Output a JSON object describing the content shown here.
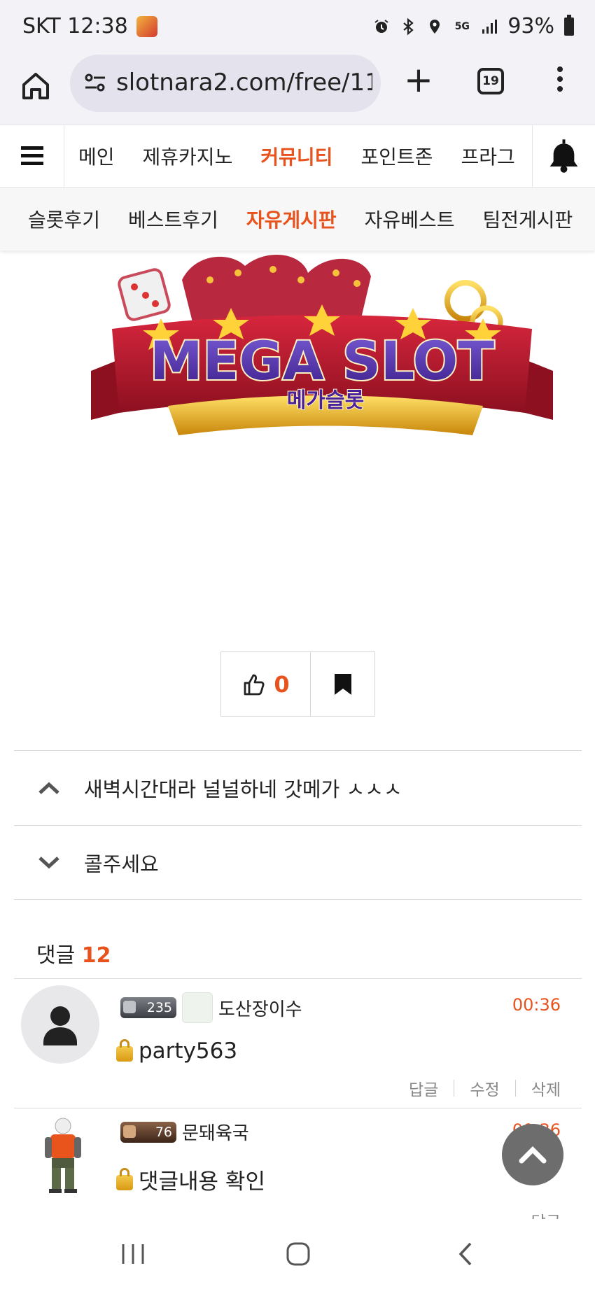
{
  "status_bar": {
    "carrier_time": "SKT 12:38",
    "network": "5G",
    "battery": "93%"
  },
  "browser": {
    "url": "slotnara2.com/free/11",
    "tab_count": "19"
  },
  "site_nav": {
    "items": [
      {
        "label": "메인",
        "active": false
      },
      {
        "label": "제휴카지노",
        "active": false
      },
      {
        "label": "커뮤니티",
        "active": true
      },
      {
        "label": "포인트존",
        "active": false
      },
      {
        "label": "프라그",
        "active": false
      }
    ]
  },
  "sub_nav": {
    "items": [
      {
        "label": "슬롯후기",
        "active": false
      },
      {
        "label": "베스트후기",
        "active": false
      },
      {
        "label": "자유게시판",
        "active": true
      },
      {
        "label": "자유베스트",
        "active": false
      },
      {
        "label": "팀전게시판",
        "active": false
      }
    ]
  },
  "banner": {
    "title": "MEGA SLOT",
    "subtitle": "메가슬롯"
  },
  "post_actions": {
    "like_count": "0"
  },
  "post_nav": {
    "prev_title": "새벽시간대라 널널하네 갓메가 ㅅㅅㅅ",
    "next_title": "콜주세요"
  },
  "comments": {
    "label": "댓글",
    "count": "12",
    "items": [
      {
        "level": "235",
        "nickname": "도산장이수",
        "time": "00:36",
        "body": "party563",
        "actions": [
          "답글",
          "수정",
          "삭제"
        ]
      },
      {
        "level": "76",
        "nickname": "문돼육국",
        "time": "00:36",
        "body": "댓글내용 확인",
        "actions": [
          "답글"
        ]
      }
    ]
  }
}
